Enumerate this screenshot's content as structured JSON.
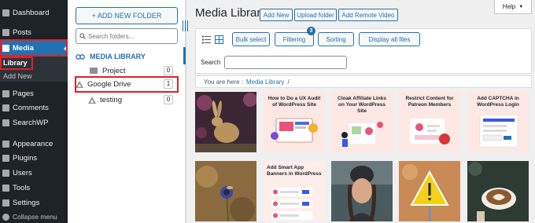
{
  "admin_menu": {
    "items": [
      {
        "label": "Dashboard",
        "icon": "dashboard-icon"
      },
      {
        "label": "Posts",
        "icon": "pin-icon"
      },
      {
        "label": "Media",
        "icon": "media-icon"
      },
      {
        "label": "Pages",
        "icon": "page-icon"
      },
      {
        "label": "Comments",
        "icon": "comment-icon"
      },
      {
        "label": "SearchWP",
        "icon": "search-icon"
      },
      {
        "label": "Appearance",
        "icon": "brush-icon"
      },
      {
        "label": "Plugins",
        "icon": "plug-icon"
      },
      {
        "label": "Users",
        "icon": "user-icon"
      },
      {
        "label": "Tools",
        "icon": "wrench-icon"
      },
      {
        "label": "Settings",
        "icon": "settings-icon"
      }
    ],
    "submenu": [
      "Library",
      "Add New"
    ],
    "collapse_label": "Collapse menu"
  },
  "folders": {
    "add_folder_label": "+ ADD NEW FOLDER",
    "search_placeholder": "Search folders...",
    "media_library_label": "MEDIA LIBRARY",
    "items": [
      {
        "label": "Project",
        "count": "0"
      },
      {
        "label": "Google Drive",
        "count": "1"
      },
      {
        "label": "testing",
        "count": "0"
      }
    ]
  },
  "main": {
    "title": "Media Library",
    "add_new": "Add New",
    "upload_folder": "Upload folder",
    "add_remote_video": "Add Remote Video",
    "help": "Help",
    "bulk_select": "Bulk select",
    "filtering": "Filtering",
    "filter_count": "3",
    "sorting": "Sorting",
    "display_all_files": "Display all files",
    "search_label": "Search",
    "breadcrumb_prefix": "You are here :",
    "breadcrumb_link": "Media Library",
    "breadcrumb_sep": "/"
  },
  "thumbnails": [
    {
      "title": ""
    },
    {
      "title": "How to Do a UX Audit of WordPress Site"
    },
    {
      "title": "Cloak Affiliate Links on Your WordPress Site"
    },
    {
      "title": "Restrict Content for Patreon Members"
    },
    {
      "title": "Add CAPTCHA in WordPress Login"
    },
    {
      "title": ""
    },
    {
      "title": "Add Smart App Banners in WordPress"
    },
    {
      "title": ""
    },
    {
      "title": ""
    },
    {
      "title": ""
    }
  ],
  "colors": {
    "accent": "#2271b1",
    "sidebar_bg": "#1d2327",
    "highlight": "#e0202a"
  }
}
